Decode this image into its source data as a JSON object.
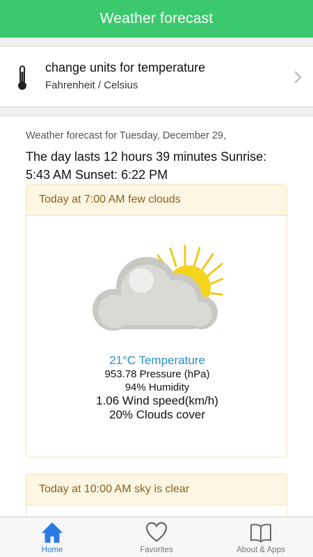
{
  "header": {
    "title": "Weather forecast"
  },
  "units_setting": {
    "title": "change units for temperature",
    "subtitle": "Fahrenheit / Celsius",
    "icon": "thermometer-icon"
  },
  "forecast": {
    "intro": "Weather forecast for Tuesday, December 29,",
    "day_info": "The day lasts 12 hours 39 minutes Sunrise: 5:43 AM Sunset: 6:22 PM",
    "cards": [
      {
        "heading": "Today at 7:00 AM few clouds",
        "icon": "partly-cloudy-icon",
        "temperature": "21°C Temperature",
        "pressure": "953.78 Pressure (hPa)",
        "humidity": "94% Humidity",
        "wind": "1.06 Wind speed(km/h)",
        "clouds": "20% Clouds cover"
      },
      {
        "heading": "Today at 10:00 AM sky is clear"
      }
    ]
  },
  "tabbar": {
    "tabs": [
      {
        "label": "Home",
        "icon": "home-icon",
        "active": true
      },
      {
        "label": "Favorites",
        "icon": "heart-icon",
        "active": false
      },
      {
        "label": "About & Apps",
        "icon": "book-icon",
        "active": false
      }
    ]
  },
  "colors": {
    "header_bg": "#3cc96e",
    "card_header_bg": "#fcf6e2",
    "card_header_text": "#8a6224",
    "temperature_text": "#2a8ecb",
    "active_tab": "#2a7be4"
  }
}
